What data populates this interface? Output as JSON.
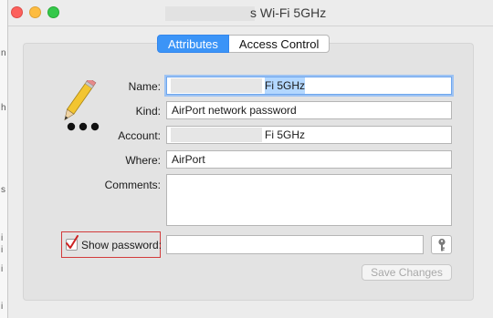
{
  "window": {
    "title": "s Wi-Fi 5GHz"
  },
  "background": {
    "chars": [
      "n",
      "h",
      "s",
      "i",
      "i",
      "i",
      "i"
    ]
  },
  "tabs": [
    {
      "label": "Attributes",
      "active": true
    },
    {
      "label": "Access Control",
      "active": false
    }
  ],
  "form": {
    "name_label": "Name:",
    "name_value": "Fi 5GHz",
    "kind_label": "Kind:",
    "kind_value": "AirPort network password",
    "account_label": "Account:",
    "account_value": "Fi 5GHz",
    "where_label": "Where:",
    "where_value": "AirPort",
    "comments_label": "Comments:",
    "comments_value": "",
    "show_password_label": "Show password:",
    "show_password_checked": true,
    "password_value": ""
  },
  "buttons": {
    "save_label": "Save Changes",
    "save_enabled": false
  },
  "icons": {
    "app_icon": "pencil-ellipsis-icon",
    "key_icon": "key-icon"
  },
  "colors": {
    "accent": "#3b94f7",
    "highlight_box": "#d23b3b",
    "check_red": "#cc2222"
  }
}
